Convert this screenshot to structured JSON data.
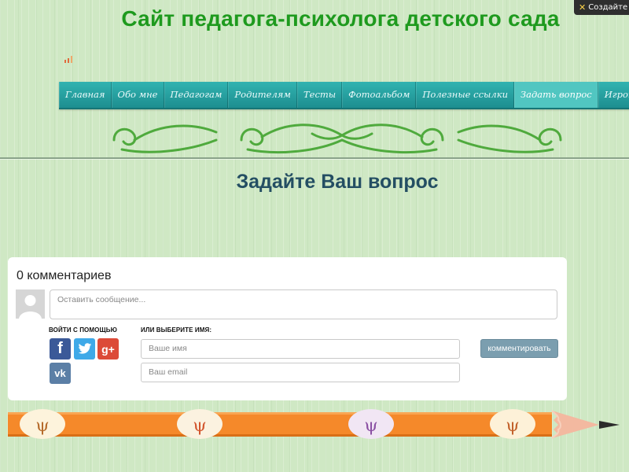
{
  "toolbar": {
    "create_label": "Создайте"
  },
  "site": {
    "title": "Сайт педагога-психолога детского сада"
  },
  "menu": {
    "items": [
      {
        "label": "Главная"
      },
      {
        "label": "Обо мне"
      },
      {
        "label": "Педагогам"
      },
      {
        "label": "Родителям"
      },
      {
        "label": "Тесты"
      },
      {
        "label": "Фотоальбом"
      },
      {
        "label": "Полезные ссылки"
      },
      {
        "label": "Задать вопрос",
        "active": true
      },
      {
        "label": "Игротека"
      }
    ]
  },
  "page": {
    "title": "Задайте Ваш вопрос"
  },
  "comments": {
    "count_label": "0 комментариев",
    "message_placeholder": "Оставить сообщение...",
    "login_with_label": "ВОЙТИ С ПОМОЩЬЮ",
    "or_name_label": "ИЛИ ВЫБЕРИТЕ ИМЯ:",
    "name_placeholder": "Ваше имя",
    "email_placeholder": "Ваш email",
    "submit_label": "комментировать",
    "social": [
      {
        "icon": "facebook-icon",
        "glyph": "f",
        "color": "#3b5998"
      },
      {
        "icon": "twitter-icon",
        "color": "#3fa9e8"
      },
      {
        "icon": "google-plus-icon",
        "glyph": "g+",
        "color": "#dc4a38"
      },
      {
        "icon": "vk-icon",
        "glyph": "vk",
        "color": "#5b7fa6"
      }
    ]
  },
  "colors": {
    "title_green": "#1e9a1e",
    "menu_teal": "#1d8e90",
    "page_title": "#244e63",
    "pencil_orange": "#f5892a"
  }
}
